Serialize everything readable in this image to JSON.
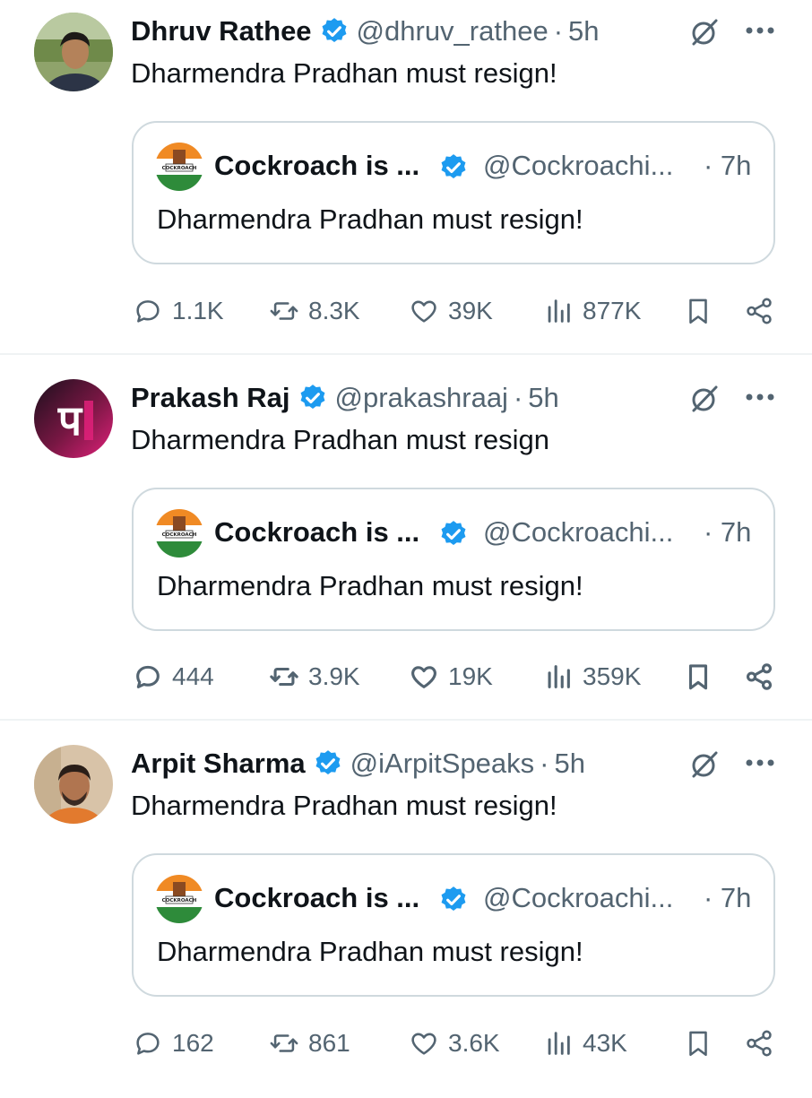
{
  "colors": {
    "text": "#0f1419",
    "secondary": "#536471",
    "verified": "#1d9bf0",
    "border": "#cfd9de",
    "divider": "#eff3f4"
  },
  "tweets": [
    {
      "author": "Dhruv Rathee",
      "handle": "@dhruv_rathee",
      "separator": "·",
      "time": "5h",
      "text": "Dharmendra Pradhan must resign!",
      "avatar": "person-photo-avatar",
      "quote": {
        "author": "Cockroach is ...",
        "handle": "@Cockroachi...",
        "time": "· 7h",
        "text": "Dharmendra Pradhan must resign!",
        "avatar_text": "COCKROACH"
      },
      "stats": {
        "replies": "1.1K",
        "reposts": "8.3K",
        "likes": "39K",
        "views": "877K"
      }
    },
    {
      "author": "Prakash Raj",
      "handle": "@prakashraaj",
      "separator": "·",
      "time": "5h",
      "text": "Dharmendra Pradhan must resign",
      "avatar": "pr-logo-avatar",
      "quote": {
        "author": "Cockroach is ...",
        "handle": "@Cockroachi...",
        "time": "· 7h",
        "text": "Dharmendra Pradhan must resign!",
        "avatar_text": "COCKROACH"
      },
      "stats": {
        "replies": "444",
        "reposts": "3.9K",
        "likes": "19K",
        "views": "359K"
      }
    },
    {
      "author": "Arpit Sharma",
      "handle": "@iArpitSpeaks",
      "separator": "·",
      "time": "5h",
      "text": "Dharmendra Pradhan must resign!",
      "avatar": "person-photo-avatar",
      "quote": {
        "author": "Cockroach is ...",
        "handle": "@Cockroachi...",
        "time": "· 7h",
        "text": "Dharmendra Pradhan must resign!",
        "avatar_text": "COCKROACH"
      },
      "stats": {
        "replies": "162",
        "reposts": "861",
        "likes": "3.6K",
        "views": "43K"
      }
    }
  ]
}
